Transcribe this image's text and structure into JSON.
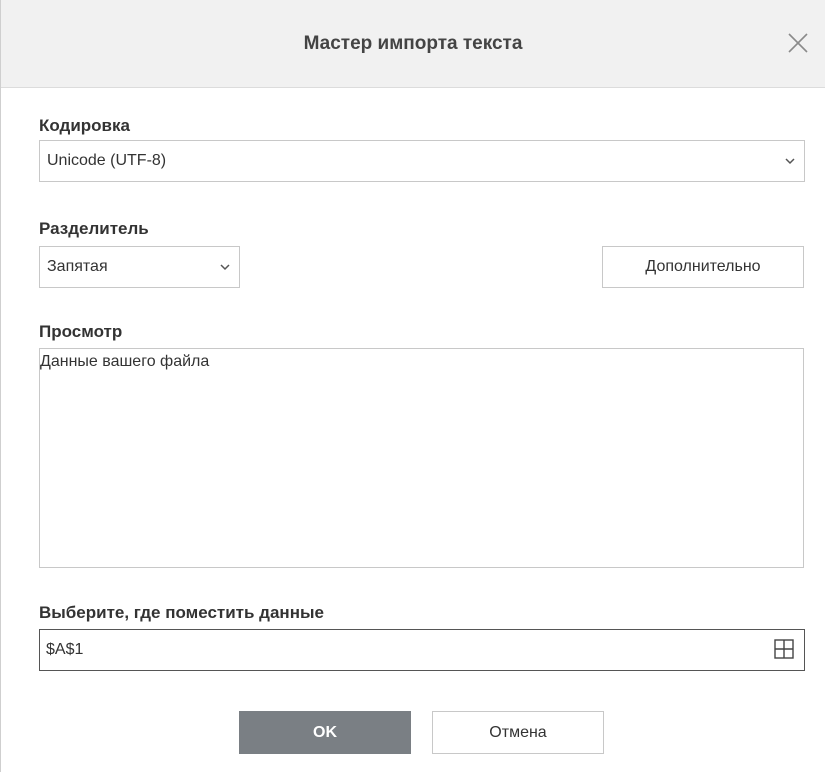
{
  "dialog": {
    "title": "Мастер импорта текста"
  },
  "encoding": {
    "label": "Кодировка",
    "value": "Unicode (UTF-8)"
  },
  "delimiter": {
    "label": "Разделитель",
    "value": "Запятая",
    "advanced_label": "Дополнительно"
  },
  "preview": {
    "label": "Просмотр",
    "content": "Данные вашего файла"
  },
  "destination": {
    "label": "Выберите, где поместить данные",
    "value": "$A$1"
  },
  "buttons": {
    "ok_label": "OK",
    "cancel_label": "Отмена"
  },
  "colors": {
    "ok_button": "#7a7f84",
    "titlebar": "#f1f1f1"
  }
}
